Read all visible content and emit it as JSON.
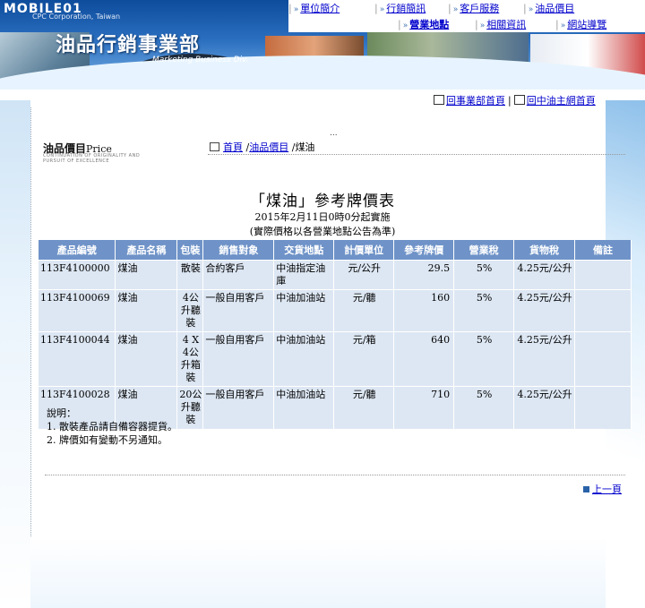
{
  "logo": {
    "mobile": "MOBILE01",
    "company": "CPC Corporation, Taiwan"
  },
  "banner": {
    "title": "油品行銷事業部",
    "subtitle": "Marketing Business Div."
  },
  "nav": {
    "items": [
      {
        "label": "單位簡介"
      },
      {
        "label": "行銷簡訊"
      },
      {
        "label": "客戶服務"
      },
      {
        "label": "油品價目"
      },
      {
        "label": "營業地點"
      },
      {
        "label": "相關資訊"
      },
      {
        "label": "網站導覽"
      }
    ]
  },
  "home_links": {
    "division_home": "回事業部首頁",
    "separator": "|",
    "main_home": "回中油主網首頁"
  },
  "section": {
    "dots": "...",
    "title_zh": "油品價目",
    "title_en": "Price",
    "subtitle": "CONTINUATION OF ORIGINALITY AND PURSUIT OF EXCELLENCE"
  },
  "breadcrumb": {
    "home": "首頁",
    "sep1": "/",
    "prices": "油品價目",
    "sep2": "/",
    "current": "煤油"
  },
  "table": {
    "title": "「煤油」參考牌價表",
    "effective": "2015年2月11日0時0分起實施",
    "note": "(實際價格以各營業地點公告為準)",
    "headers": [
      "產品編號",
      "產品名稱",
      "包裝",
      "銷售對象",
      "交貨地點",
      "計價單位",
      "參考牌價",
      "營業稅",
      "貨物稅",
      "備註"
    ],
    "rows": [
      {
        "code": "113F4100000",
        "name": "煤油",
        "pack": "散裝",
        "target": "合約客戶",
        "place": "中油指定油庫",
        "unit": "元/公升",
        "price": "29.5",
        "tax": "5%",
        "goods_tax": "4.25元/公升",
        "remark": ""
      },
      {
        "code": "113F4100069",
        "name": "煤油",
        "pack": "4公升聽裝",
        "target": "一般自用客戶",
        "place": "中油加油站",
        "unit": "元/聽",
        "price": "160",
        "tax": "5%",
        "goods_tax": "4.25元/公升",
        "remark": ""
      },
      {
        "code": "113F4100044",
        "name": "煤油",
        "pack": "4 X 4公升箱裝",
        "target": "一般自用客戶",
        "place": "中油加油站",
        "unit": "元/箱",
        "price": "640",
        "tax": "5%",
        "goods_tax": "4.25元/公升",
        "remark": ""
      },
      {
        "code": "113F4100028",
        "name": "煤油",
        "pack": "20公升聽裝",
        "target": "一般自用客戶",
        "place": "中油加油站",
        "unit": "元/聽",
        "price": "710",
        "tax": "5%",
        "goods_tax": "4.25元/公升",
        "remark": ""
      }
    ]
  },
  "remarks": {
    "heading": "說明：",
    "items": [
      "1. 散裝產品請自備容器提貨。",
      "2. 牌價如有變動不另通知。"
    ]
  },
  "prev_link": "上一頁"
}
